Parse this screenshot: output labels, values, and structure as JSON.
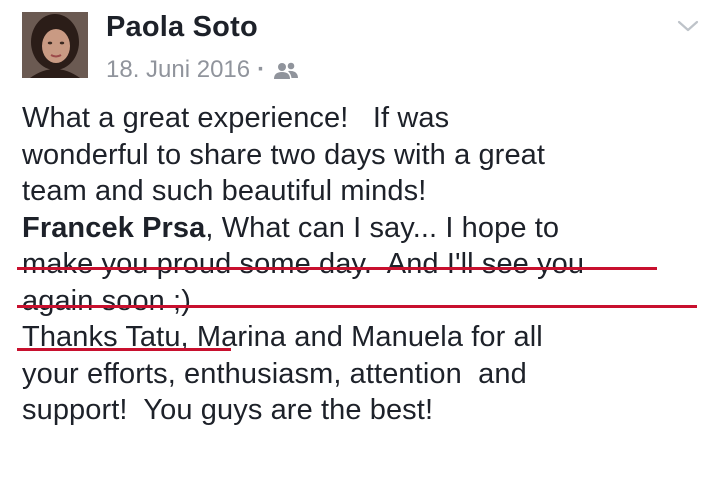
{
  "post": {
    "author": "Paola Soto",
    "date": "18. Juni 2016",
    "separator": "·",
    "audience_icon": "friends-icon",
    "menu_icon": "chevron-down-icon",
    "lines": [
      "What a great experience!   If was",
      "wonderful to share two days with a great",
      "team and such beautiful minds!",
      "",
      "make you proud some day.  And I'll see you",
      "again soon ;)",
      "Thanks Tatu, Marina and Manuela for all",
      "your efforts, enthusiasm, attention  and",
      "support!  You guys are the best!"
    ],
    "mention_name": "Francek Prsa",
    "mention_rest": ", What can I say... I hope to"
  },
  "colors": {
    "text": "#1d2129",
    "meta": "#90949c",
    "annotation_underline": "#c8102e"
  }
}
